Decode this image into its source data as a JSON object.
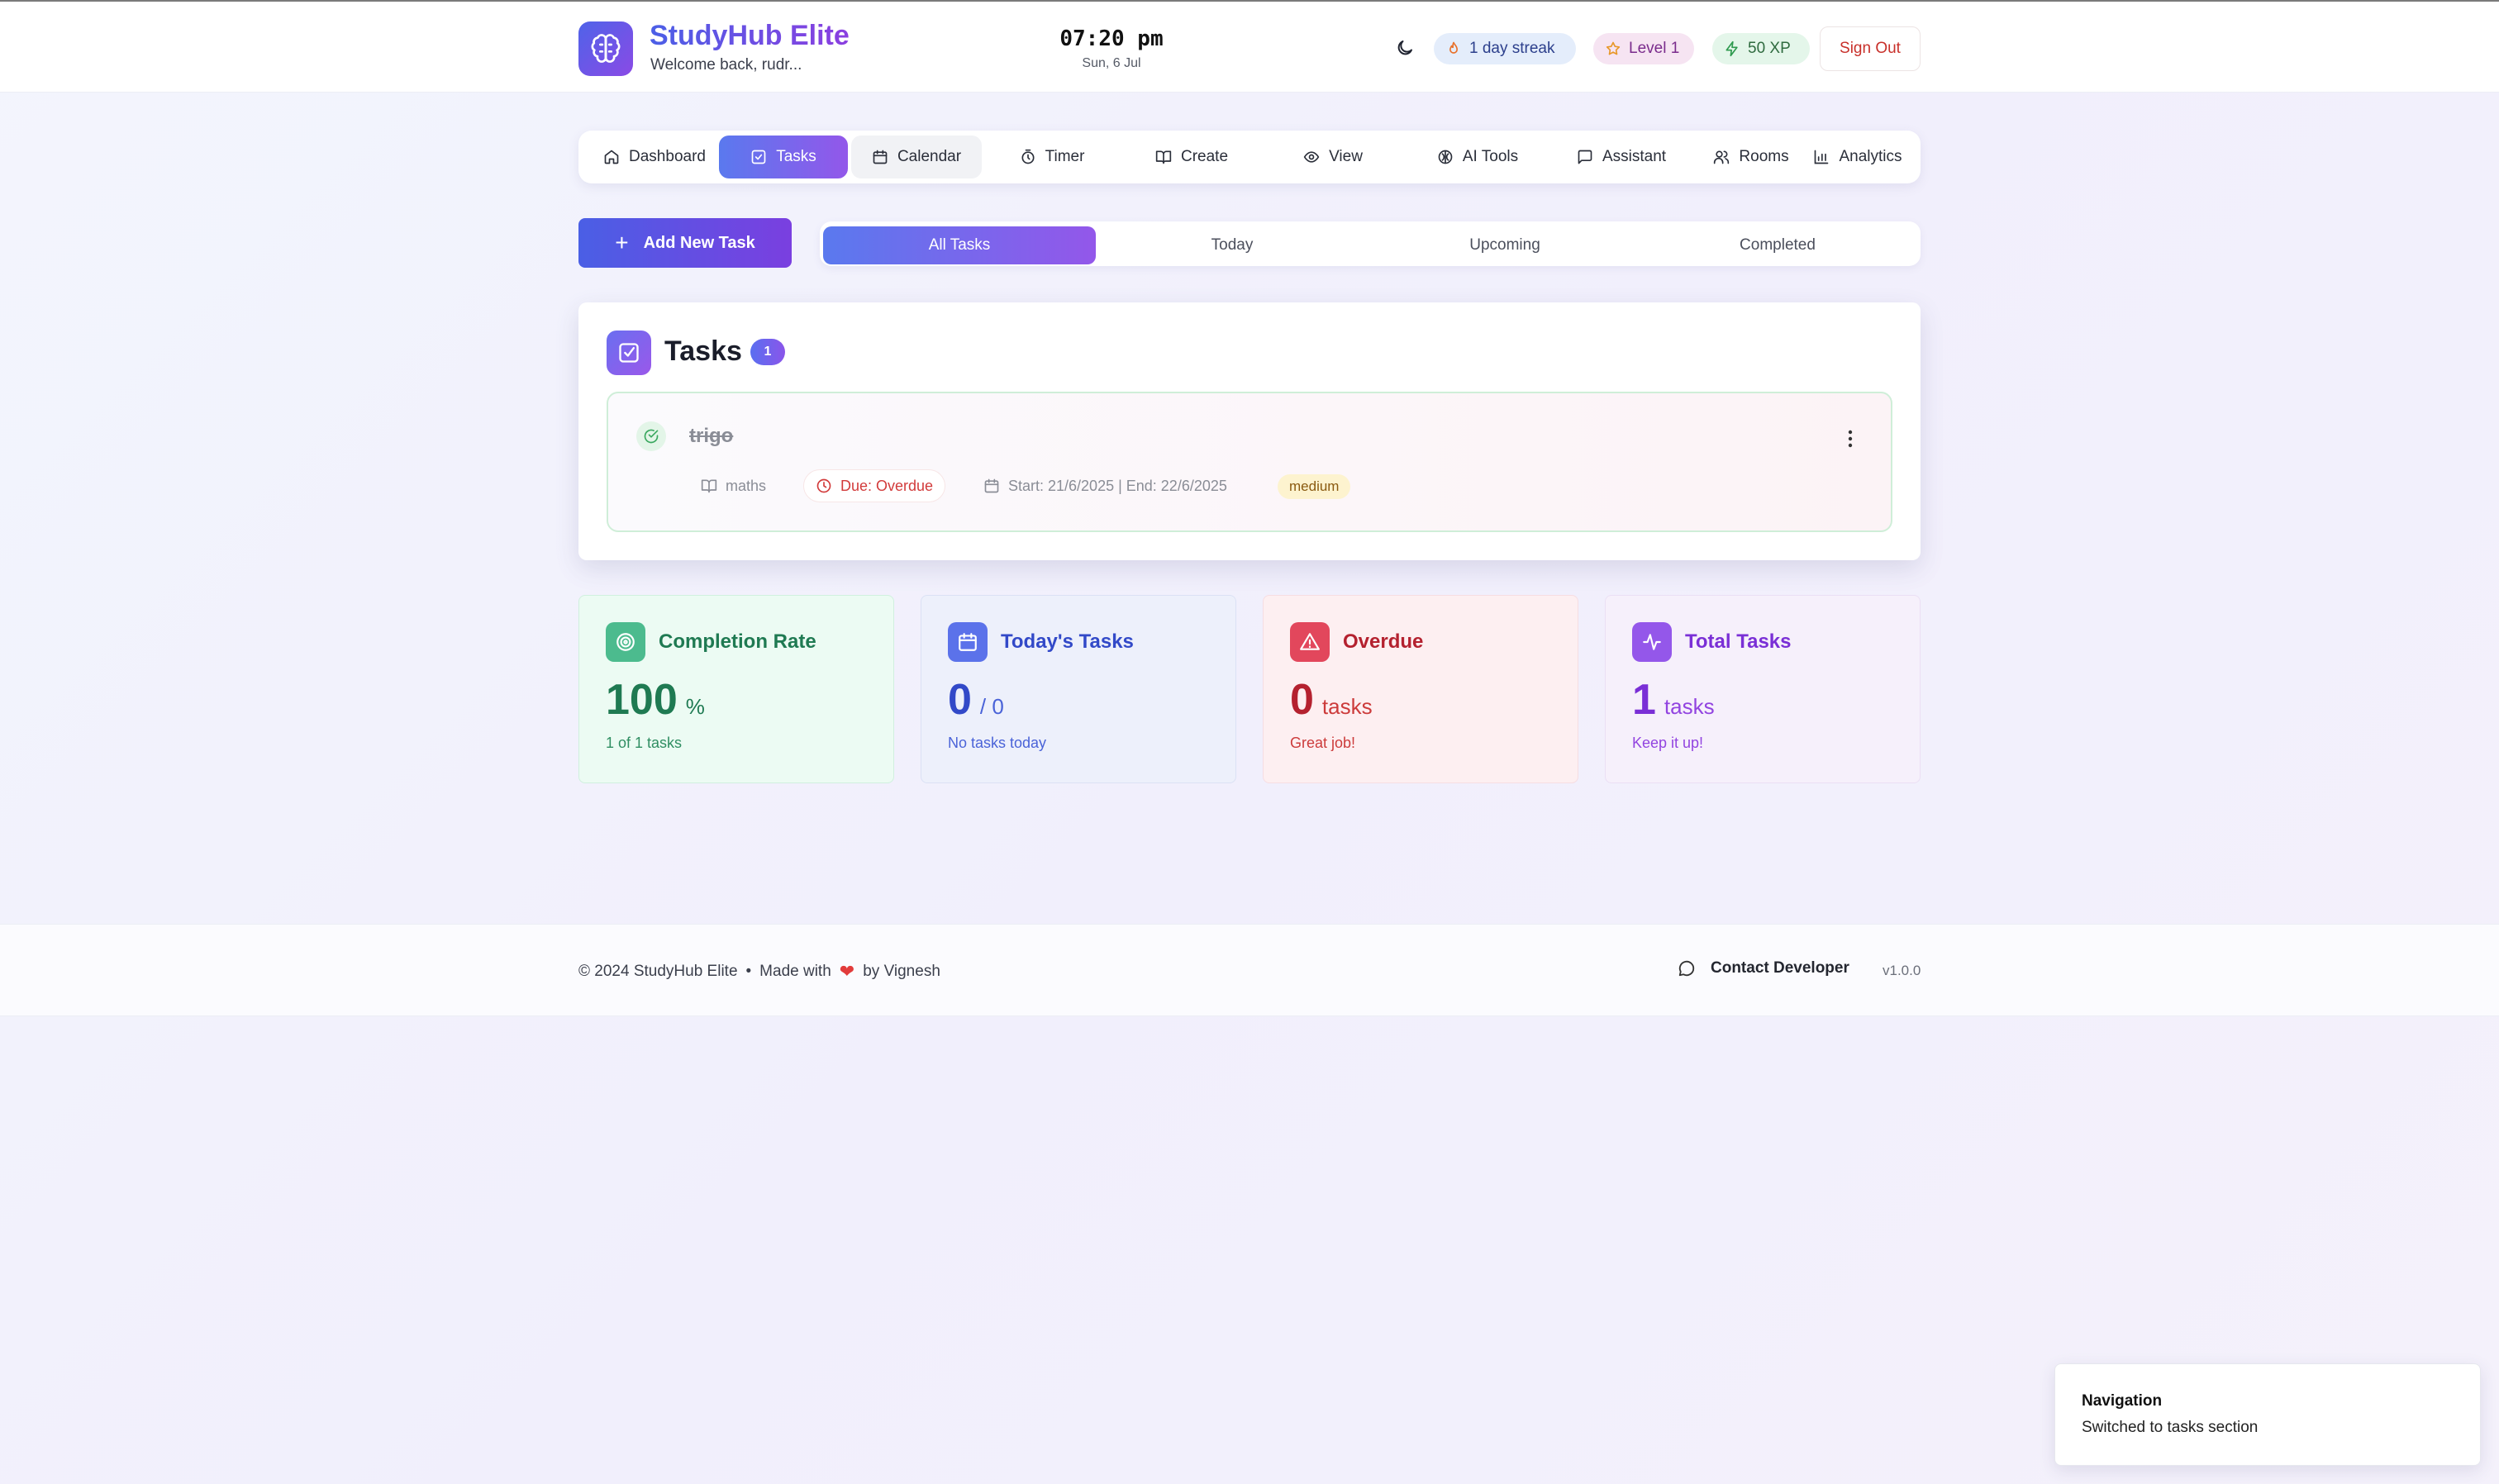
{
  "header": {
    "brand_title": "StudyHub Elite",
    "welcome": "Welcome back, rudr...",
    "time": "07:20 pm",
    "date": "Sun, 6 Jul",
    "streak": "1 day streak",
    "level": "Level 1",
    "xp": "50 XP",
    "sign_out": "Sign Out"
  },
  "nav": {
    "items": [
      {
        "label": "Dashboard",
        "icon": "home-icon"
      },
      {
        "label": "Tasks",
        "icon": "checkbox-icon"
      },
      {
        "label": "Calendar",
        "icon": "calendar-icon"
      },
      {
        "label": "Timer",
        "icon": "timer-icon"
      },
      {
        "label": "Create",
        "icon": "book-icon"
      },
      {
        "label": "View",
        "icon": "eye-icon"
      },
      {
        "label": "AI Tools",
        "icon": "brain-icon"
      },
      {
        "label": "Assistant",
        "icon": "chat-icon"
      },
      {
        "label": "Rooms",
        "icon": "users-icon"
      },
      {
        "label": "Analytics",
        "icon": "bar-chart-icon"
      }
    ],
    "active": "Tasks"
  },
  "actions": {
    "add_task": "Add New Task"
  },
  "filters": {
    "tabs": [
      "All Tasks",
      "Today",
      "Upcoming",
      "Completed"
    ],
    "active": "All Tasks"
  },
  "tasks": {
    "title": "Tasks",
    "count": "1",
    "items": [
      {
        "name": "trigo",
        "subject": "maths",
        "due": "Due: Overdue",
        "dates": "Start: 21/6/2025 | End: 22/6/2025",
        "priority": "medium",
        "completed": true
      }
    ]
  },
  "stats": {
    "completion": {
      "label": "Completion Rate",
      "value": "100",
      "unit": "%",
      "note": "1 of 1 tasks"
    },
    "today": {
      "label": "Today's Tasks",
      "value": "0",
      "unit": "/ 0",
      "note": "No tasks today"
    },
    "overdue": {
      "label": "Overdue",
      "value": "0",
      "unit": "tasks",
      "note": "Great job!"
    },
    "total": {
      "label": "Total Tasks",
      "value": "1",
      "unit": "tasks",
      "note": "Keep it up!"
    }
  },
  "footer": {
    "copyright": "© 2024 StudyHub Elite",
    "separator": "•",
    "made_with": "Made with",
    "by": "by Vignesh",
    "contact": "Contact Developer",
    "version": "v1.0.0"
  },
  "toast": {
    "title": "Navigation",
    "message": "Switched to tasks section"
  },
  "colors": {
    "accent_start": "#5a79ee",
    "accent_end": "#9357ea",
    "danger": "#c8302a"
  }
}
